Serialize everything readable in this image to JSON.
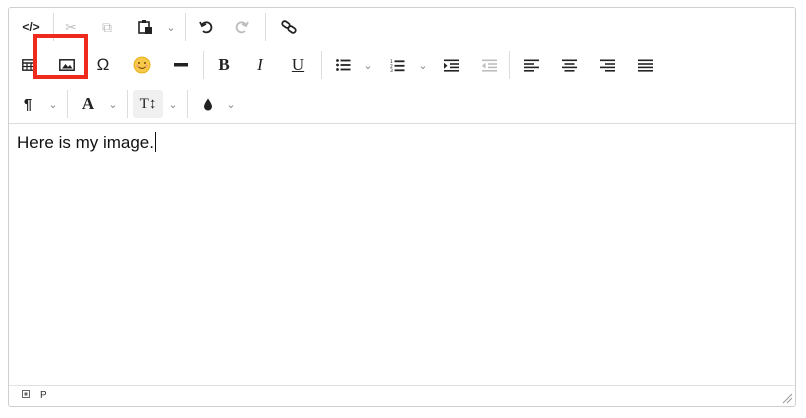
{
  "toolbar": {
    "row1": {
      "source_code": "</>",
      "cut": "✂",
      "copy": "⧉",
      "paste": "📋",
      "undo": "↶",
      "redo": "↷",
      "link": "🔗"
    },
    "row2": {
      "table": "▦",
      "image": "🖼",
      "special_char": "Ω",
      "emoji": "😊",
      "horizontal_rule": "━",
      "bold": "B",
      "italic": "I",
      "underline": "U",
      "bullet_list": "☰",
      "numbered_list": "☷",
      "indent": "⇥",
      "outdent": "⇤",
      "align_left": "≡",
      "align_center": "≡",
      "align_right": "≡",
      "justify": "≡"
    },
    "row3": {
      "paragraph": "¶",
      "font": "A",
      "font_size": "T↕",
      "color": "💧"
    },
    "chevron": "⌄"
  },
  "editor": {
    "content_text": "Here is my image."
  },
  "statusbar": {
    "path": "P"
  }
}
